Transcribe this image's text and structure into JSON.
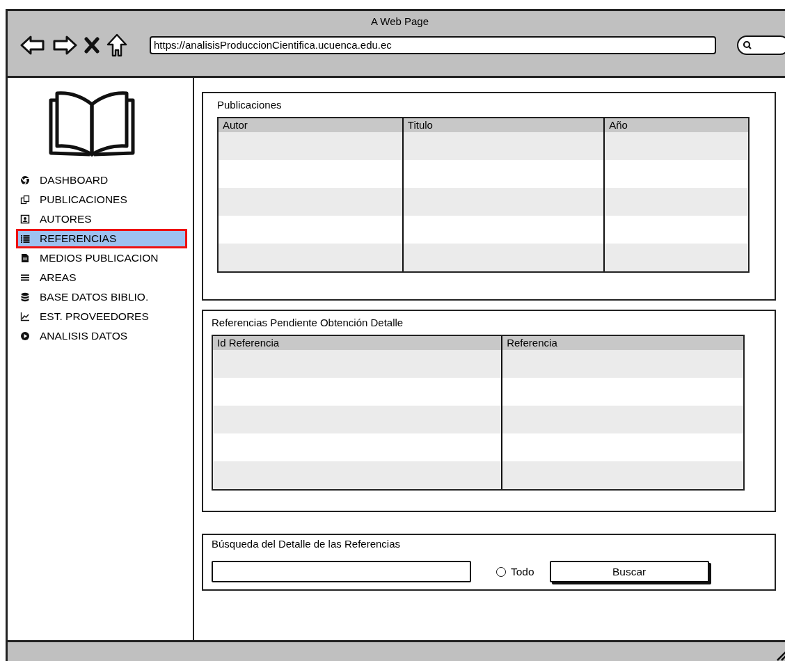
{
  "window": {
    "title": "A Web Page",
    "url": "https://analisisProduccionCientifica.ucuenca.edu.ec"
  },
  "sidebar": {
    "items": [
      {
        "label": "DASHBOARD",
        "selected": false
      },
      {
        "label": "PUBLICACIONES",
        "selected": false
      },
      {
        "label": "AUTORES",
        "selected": false
      },
      {
        "label": "REFERENCIAS",
        "selected": true
      },
      {
        "label": "MEDIOS PUBLICACION",
        "selected": false
      },
      {
        "label": "AREAS",
        "selected": false
      },
      {
        "label": "BASE DATOS BIBLIO.",
        "selected": false
      },
      {
        "label": "EST. PROVEEDORES",
        "selected": false
      },
      {
        "label": "ANALISIS DATOS",
        "selected": false
      }
    ]
  },
  "panels": [
    {
      "title": "Publicaciones",
      "columns": [
        "Autor",
        "Titulo",
        "Año"
      ]
    },
    {
      "title": "Referencias Pendiente Obtención Detalle",
      "columns": [
        "Id Referencia",
        "Referencia"
      ]
    }
  ],
  "search": {
    "title": "Búsqueda del Detalle de las Referencias",
    "radio": {
      "label": "Todo",
      "checked": false
    },
    "button": "Buscar"
  }
}
